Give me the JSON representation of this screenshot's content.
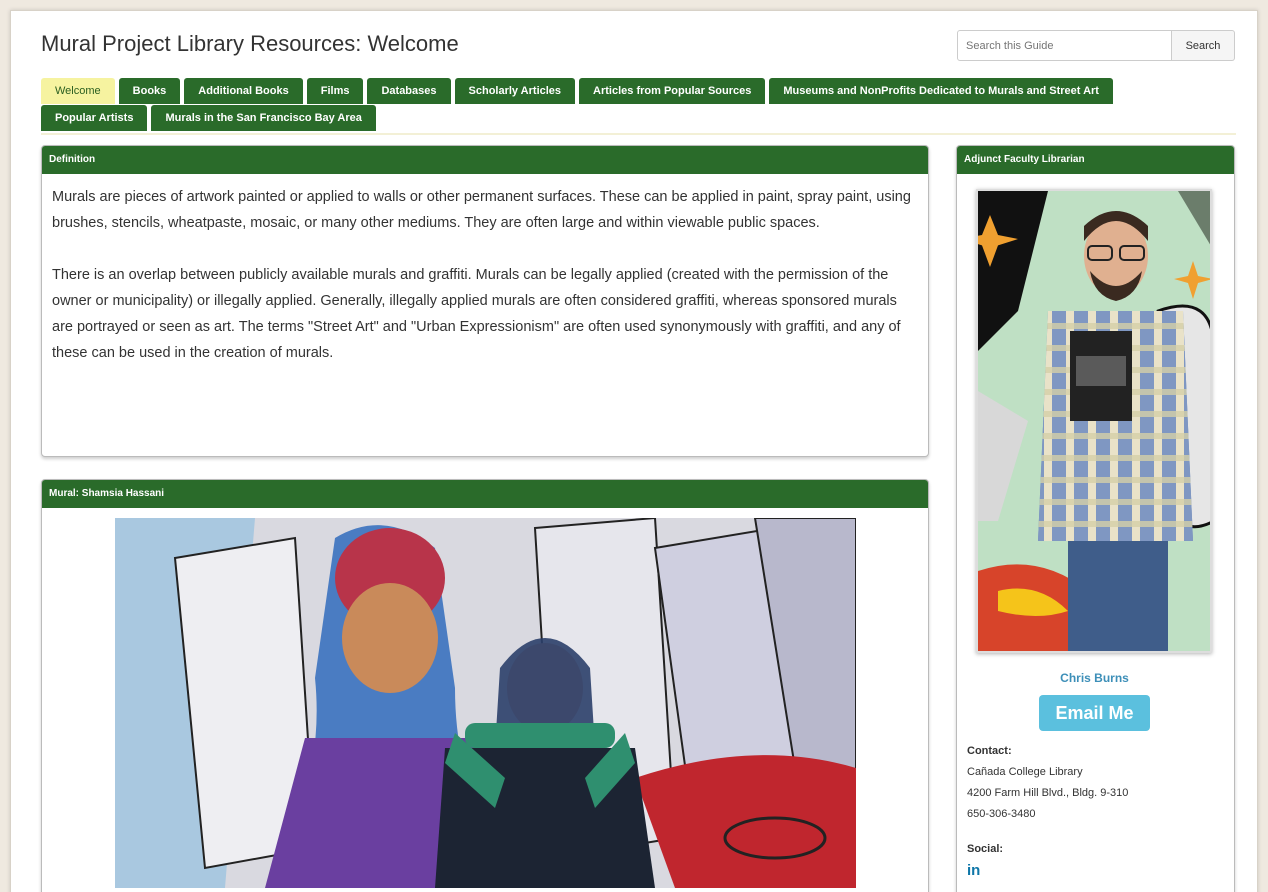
{
  "page": {
    "title": "Mural Project Library Resources: Welcome"
  },
  "search": {
    "placeholder": "Search this Guide",
    "button_label": "Search"
  },
  "tabs": {
    "row1": [
      {
        "label": "Welcome",
        "active": true
      },
      {
        "label": "Books"
      },
      {
        "label": "Additional Books"
      },
      {
        "label": "Films"
      },
      {
        "label": "Databases"
      },
      {
        "label": "Scholarly Articles"
      },
      {
        "label": "Articles from Popular Sources"
      },
      {
        "label": "Museums and NonProfits Dedicated to Murals and Street Art"
      }
    ],
    "row2": [
      {
        "label": "Popular Artists"
      },
      {
        "label": "Murals in the San Francisco Bay Area"
      }
    ]
  },
  "definition": {
    "heading": "Definition",
    "paragraph1": "Murals are pieces of artwork painted or applied to walls or other permanent surfaces. These can be applied in paint, spray paint, using brushes, stencils, wheatpaste, mosaic, or many other mediums. They are often large and within viewable public spaces.",
    "paragraph2": "There is an overlap between publicly available murals and graffiti. Murals can be legally applied (created with the permission of the owner or municipality) or illegally applied. Generally, illegally applied murals are often considered graffiti, whereas sponsored murals are portrayed or seen as art. The terms \"Street Art\" and \"Urban Expressionism\" are often used synonymously with graffiti, and any of these can be used in the creation of murals."
  },
  "mural": {
    "heading": "Mural: Shamsia Hassani"
  },
  "librarian": {
    "heading": "Adjunct Faculty Librarian",
    "name": "Chris Burns",
    "email_label": "Email Me",
    "contact_label": "Contact:",
    "contact_line1": "Cañada College Library",
    "contact_line2": "4200 Farm Hill Blvd., Bldg. 9-310",
    "contact_line3": "650-306-3480",
    "social_label": "Social:",
    "social_icon": "in"
  },
  "colors": {
    "tab_green": "#2a6b2a",
    "active_tab": "#f6f3a0",
    "email_button": "#5bc0de",
    "link_blue": "#3d8fb8"
  }
}
